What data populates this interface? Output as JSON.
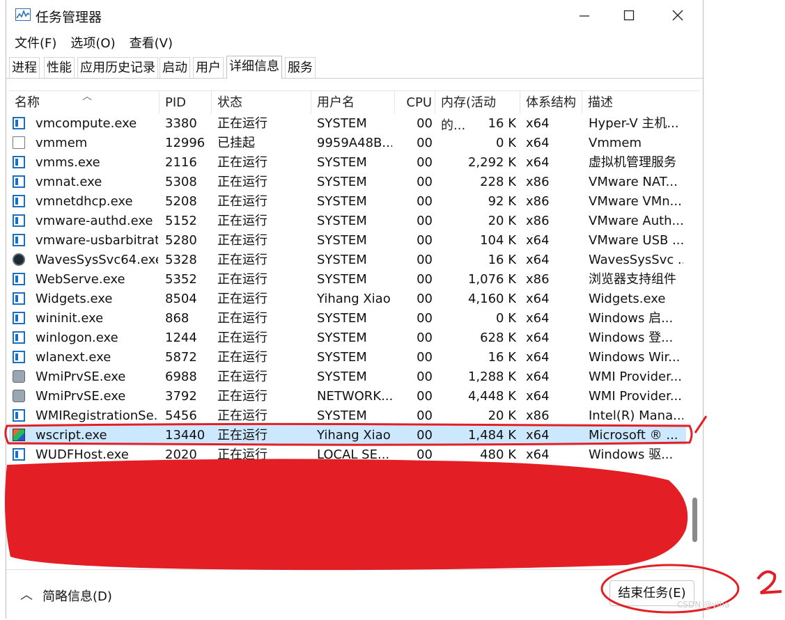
{
  "window": {
    "title": "任务管理器",
    "minimize_icon": "minimize-icon",
    "maximize_icon": "maximize-icon",
    "close_icon": "close-icon"
  },
  "menu": [
    "文件(F)",
    "选项(O)",
    "查看(V)"
  ],
  "tabs": [
    {
      "label": "进程"
    },
    {
      "label": "性能"
    },
    {
      "label": "应用历史记录"
    },
    {
      "label": "启动"
    },
    {
      "label": "用户"
    },
    {
      "label": "详细信息",
      "active": true
    },
    {
      "label": "服务"
    }
  ],
  "columns": {
    "name": "名称",
    "pid": "PID",
    "status": "状态",
    "user": "用户名",
    "cpu": "CPU",
    "memory": "内存(活动的...",
    "arch": "体系结构",
    "desc": "描述"
  },
  "rows": [
    {
      "icon": "app-icon",
      "name": "vmcompute.exe",
      "pid": "3380",
      "status": "正在运行",
      "user": "SYSTEM",
      "cpu": "00",
      "memory": "16 K",
      "arch": "x64",
      "desc": "Hyper-V 主机..."
    },
    {
      "icon": "document-icon",
      "name": "vmmem",
      "pid": "12996",
      "status": "已挂起",
      "user": "9959A48B...",
      "cpu": "00",
      "memory": "0 K",
      "arch": "x64",
      "desc": "Vmmem"
    },
    {
      "icon": "app-icon",
      "name": "vmms.exe",
      "pid": "2116",
      "status": "正在运行",
      "user": "SYSTEM",
      "cpu": "00",
      "memory": "2,292 K",
      "arch": "x64",
      "desc": "虚拟机管理服务"
    },
    {
      "icon": "app-icon",
      "name": "vmnat.exe",
      "pid": "5308",
      "status": "正在运行",
      "user": "SYSTEM",
      "cpu": "00",
      "memory": "228 K",
      "arch": "x86",
      "desc": "VMware NAT..."
    },
    {
      "icon": "app-icon",
      "name": "vmnetdhcp.exe",
      "pid": "5208",
      "status": "正在运行",
      "user": "SYSTEM",
      "cpu": "00",
      "memory": "92 K",
      "arch": "x86",
      "desc": "VMware VMn..."
    },
    {
      "icon": "app-icon",
      "name": "vmware-authd.exe",
      "pid": "5152",
      "status": "正在运行",
      "user": "SYSTEM",
      "cpu": "00",
      "memory": "20 K",
      "arch": "x86",
      "desc": "VMware Auth..."
    },
    {
      "icon": "app-icon",
      "name": "vmware-usbarbitrat...",
      "pid": "5280",
      "status": "正在运行",
      "user": "SYSTEM",
      "cpu": "00",
      "memory": "104 K",
      "arch": "x64",
      "desc": "VMware USB ..."
    },
    {
      "icon": "waves-icon",
      "name": "WavesSysSvc64.exe",
      "pid": "5328",
      "status": "正在运行",
      "user": "SYSTEM",
      "cpu": "00",
      "memory": "16 K",
      "arch": "x64",
      "desc": "WavesSysSvc ..."
    },
    {
      "icon": "app-icon",
      "name": "WebServe.exe",
      "pid": "5352",
      "status": "正在运行",
      "user": "SYSTEM",
      "cpu": "00",
      "memory": "1,076 K",
      "arch": "x86",
      "desc": "浏览器支持组件"
    },
    {
      "icon": "app-icon",
      "name": "Widgets.exe",
      "pid": "8504",
      "status": "正在运行",
      "user": "Yihang Xiao",
      "cpu": "00",
      "memory": "4,160 K",
      "arch": "x64",
      "desc": "Widgets.exe"
    },
    {
      "icon": "app-icon",
      "name": "wininit.exe",
      "pid": "868",
      "status": "正在运行",
      "user": "SYSTEM",
      "cpu": "00",
      "memory": "0 K",
      "arch": "x64",
      "desc": "Windows 启..."
    },
    {
      "icon": "app-icon",
      "name": "winlogon.exe",
      "pid": "1244",
      "status": "正在运行",
      "user": "SYSTEM",
      "cpu": "00",
      "memory": "628 K",
      "arch": "x64",
      "desc": "Windows 登..."
    },
    {
      "icon": "app-icon",
      "name": "wlanext.exe",
      "pid": "5872",
      "status": "正在运行",
      "user": "SYSTEM",
      "cpu": "00",
      "memory": "16 K",
      "arch": "x64",
      "desc": "Windows Wir..."
    },
    {
      "icon": "gear-app-icon",
      "name": "WmiPrvSE.exe",
      "pid": "6988",
      "status": "正在运行",
      "user": "SYSTEM",
      "cpu": "00",
      "memory": "1,288 K",
      "arch": "x64",
      "desc": "WMI Provider..."
    },
    {
      "icon": "gear-app-icon",
      "name": "WmiPrvSE.exe",
      "pid": "3792",
      "status": "正在运行",
      "user": "NETWORK...",
      "cpu": "00",
      "memory": "4,448 K",
      "arch": "x64",
      "desc": "WMI Provider..."
    },
    {
      "icon": "app-icon",
      "name": "WMIRegistrationSe...",
      "pid": "5456",
      "status": "正在运行",
      "user": "SYSTEM",
      "cpu": "00",
      "memory": "20 K",
      "arch": "x86",
      "desc": "Intel(R) Mana..."
    },
    {
      "icon": "script-icon",
      "name": "wscript.exe",
      "pid": "13440",
      "status": "正在运行",
      "user": "Yihang Xiao",
      "cpu": "00",
      "memory": "1,484 K",
      "arch": "x64",
      "desc": "Microsoft ® ...",
      "selected": true
    },
    {
      "icon": "app-icon",
      "name": "WUDFHost.exe",
      "pid": "2020",
      "status": "正在运行",
      "user": "LOCAL SE...",
      "cpu": "00",
      "memory": "480 K",
      "arch": "x64",
      "desc": "Windows 驱..."
    }
  ],
  "footer": {
    "collapse_icon": "chevron-up-icon",
    "fewer_details": "简略信息(D)",
    "end_task": "结束任务(E)"
  },
  "annotations": {
    "mark_1": "1",
    "mark_2": "2"
  },
  "watermark": "CSDN @yiha",
  "colors": {
    "selection": "#cce8ff",
    "annotation_red": "#e31e24"
  }
}
